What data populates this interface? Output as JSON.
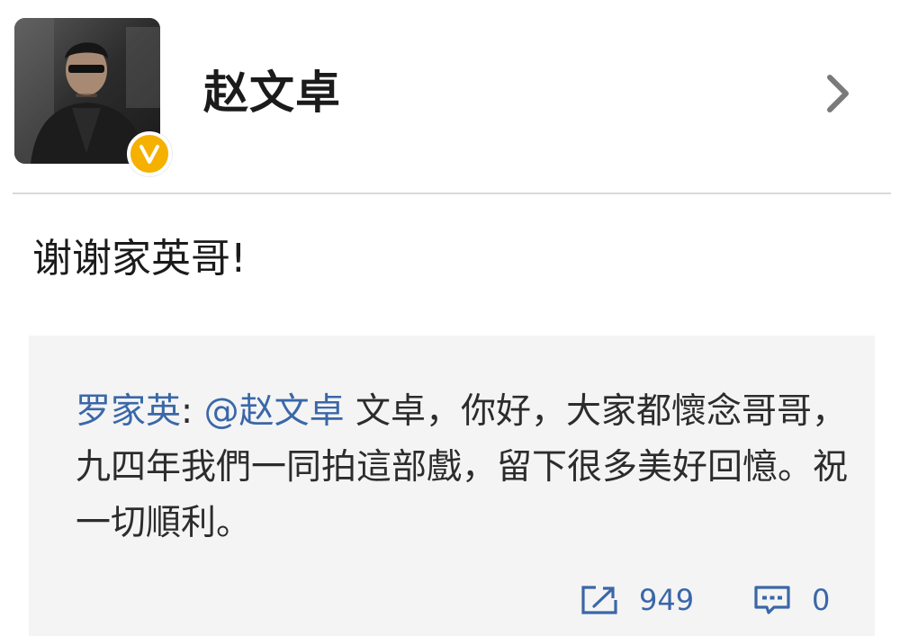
{
  "header": {
    "username": "赵文卓",
    "icons": {
      "avatar": "user-avatar",
      "verified": "verified-v-badge",
      "chevron": "chevron-right-icon"
    },
    "colors": {
      "badge": "#f5b000",
      "chevron": "#7a7a7a"
    }
  },
  "post": {
    "text": "谢谢家英哥!"
  },
  "retweet": {
    "author": "罗家英",
    "separator": ": ",
    "mention": "@赵文卓",
    "body": " 文卓，你好，大家都懷念哥哥，九四年我們一同拍這部戲，留下很多美好回憶。祝一切順利。",
    "repost_count": "949",
    "comment_count": "0",
    "colors": {
      "link": "#3a67a8",
      "background": "#f4f4f4"
    }
  }
}
